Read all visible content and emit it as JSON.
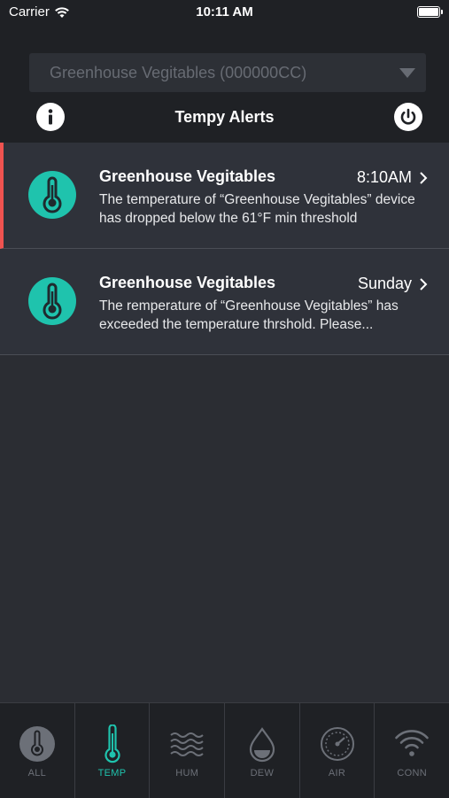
{
  "status_bar": {
    "carrier": "Carrier",
    "time": "10:11 AM"
  },
  "header": {
    "device_selector": "Greenhouse Vegitables (000000CC)",
    "title": "Tempy Alerts"
  },
  "alerts": [
    {
      "title": "Greenhouse Vegitables",
      "time": "8:10AM",
      "body": "The temperature of “Greenhouse Vegitables” device has dropped below the 61°F min threshold",
      "icon": "thermometer-icon",
      "unread": true
    },
    {
      "title": "Greenhouse Vegitables",
      "time": "Sunday",
      "body": "The remperature of  “Greenhouse Vegitables” has exceeded the temperature thrshold. Please...",
      "icon": "thermometer-icon",
      "unread": false
    }
  ],
  "tabs": [
    {
      "label": "ALL",
      "icon": "thermometer-gauge-icon",
      "active": false
    },
    {
      "label": "TEMP",
      "icon": "thermometer-icon",
      "active": true
    },
    {
      "label": "HUM",
      "icon": "waves-icon",
      "active": false
    },
    {
      "label": "DEW",
      "icon": "droplet-icon",
      "active": false
    },
    {
      "label": "AIR",
      "icon": "air-gauge-icon",
      "active": false
    },
    {
      "label": "CONN",
      "icon": "wifi-icon",
      "active": false
    }
  ],
  "colors": {
    "accent": "#1fc3ad",
    "alert_marker": "#ef5350",
    "background": "#2b2d33",
    "header_bg": "#1f2125"
  }
}
